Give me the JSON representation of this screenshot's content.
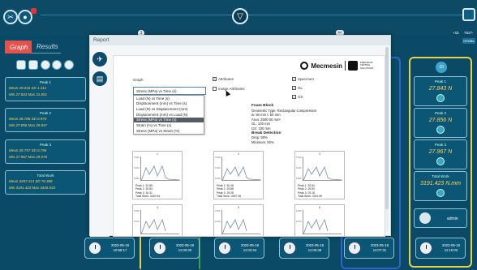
{
  "tabs": {
    "graph": "Graph",
    "results": "Results"
  },
  "top": {
    "circle_badge": "3",
    "counter": "62",
    "right_small1": "+1b",
    "right_small2": "7627-",
    "right_small3": "GFMBs"
  },
  "left_cards": [
    {
      "title": "Peak 1",
      "l1": "Mean 29.016  SD 1.311",
      "l2": "Min 27.843  Max 31.851"
    },
    {
      "title": "Peak 2",
      "l1": "Mean 28.786  SD 0.970",
      "l2": "Min 27.856  Max 29.947"
    },
    {
      "title": "Peak 3",
      "l1": "Mean 28.757  SD 0.796",
      "l2": "Min 27.967  Max 29.578"
    },
    {
      "title": "Total Work",
      "l1": "Mean 3257.114  SD 76.388",
      "l2": "Min 3191.423  Max 3445.543"
    }
  ],
  "right_column": {
    "top_number": "10",
    "cards": [
      {
        "peak": "Peak 1",
        "value": "27.843 N"
      },
      {
        "peak": "Peak 2",
        "value": "27.856 N"
      },
      {
        "peak": "Peak 3",
        "value": "27.967 N"
      },
      {
        "peak": "Total Work",
        "value": "3191.423 N.mm"
      }
    ],
    "admin": "admin"
  },
  "bottom_cards": [
    {
      "date": "2023-05-18",
      "time": "10:58:17"
    },
    {
      "date": "2023-05-18",
      "time": "11:00:30"
    },
    {
      "date": "2023-05-18",
      "time": "11:02:44"
    },
    {
      "date": "2023-05-18",
      "time": "11:05:38"
    },
    {
      "date": "2023-05-18",
      "time": "11:07:31"
    },
    {
      "date": "2023-05-18",
      "time": "11:10:03"
    }
  ],
  "modal": {
    "title": "Report",
    "brand": "Mecmesin",
    "brand2": "PRECISION TESTING SOLUTIONS",
    "graph_label": "Graph",
    "graph_select": "Stress (MPa) vs Time (s)",
    "dropdown": [
      "Load (N) vs Time (s)",
      "Displacement (mm) vs Time (s)",
      "Load (N) vs Displacement (mm)",
      "Displacement (mm) vs Load (N)",
      "Stress (MPa) vs Time (s)",
      "Strain (%) vs Time (s)",
      "Stress (MPa) vs Strain (%)"
    ],
    "selected_index": 4,
    "attributes": "Attributes",
    "image_attributes": "Image Attributes",
    "specimen": "Specimen",
    "gl": "GL",
    "gs": "GS",
    "info": {
      "title": "Foam Block",
      "l1": "Geometric Type: Rectangular Compression",
      "l2": "w: 50 mm  t: 50 mm",
      "l3": "Area: 2500.00 mm²",
      "l4": "GL: 100 mm",
      "l5": "GS: 100 mm",
      "bd": "Break Detection",
      "l6": "Drop: 90%",
      "l7": "Minimum: 50%"
    },
    "graphs": [
      {
        "num": "1",
        "p1": "Peak 1: 31.85",
        "p2": "Peak 2: 30.83",
        "p3": "Peak 3: 30.31",
        "tw": "Total Work: 3440.54"
      },
      {
        "num": "2",
        "p1": "Peak 1: 30.48",
        "p2": "Peak 2: 29.88",
        "p3": "Peak 3: 29.28",
        "tw": "Total Work: 3307.36"
      },
      {
        "num": "3",
        "p1": "Peak 1: 30.54",
        "p2": "Peak 2: 29.50",
        "p3": "Peak 3: 29.28",
        "tw": "Total Work: 3321.80"
      },
      {
        "num": "4"
      },
      {
        "num": "5"
      },
      {
        "num": "6"
      }
    ],
    "ytick_top": "0.020",
    "ytick_mid": "0.010",
    "ytick_bot": "0.000"
  }
}
